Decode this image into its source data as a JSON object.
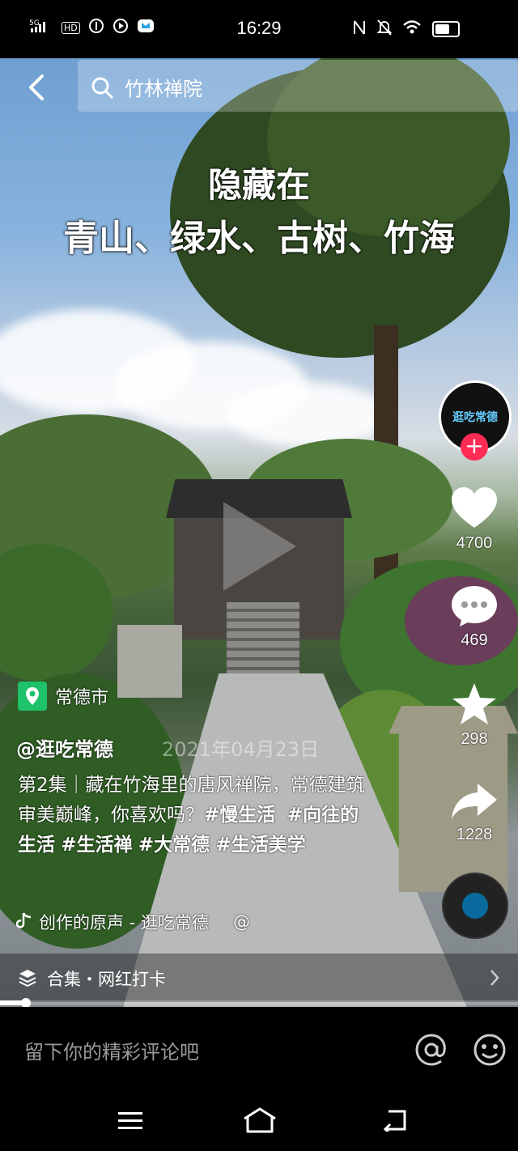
{
  "status_bar": {
    "network": "5G",
    "hd": "HD",
    "time": "16:29"
  },
  "search": {
    "query": "竹林禅院"
  },
  "overlay": {
    "line1": "隐藏在",
    "line2": "青山、绿水、古树、竹海"
  },
  "actions": {
    "avatar_text": "逛吃常德",
    "likes": "4700",
    "comments": "469",
    "favorites": "298",
    "shares": "1228"
  },
  "post": {
    "location": "常德市",
    "author": "@逛吃常德",
    "date": "2021年04月23日",
    "desc_prefix": "第2集｜藏在竹海里的唐风禅院，常德建筑审美巅峰，你喜欢吗？",
    "tags": [
      "#慢生活",
      "#向往的生活",
      "#生活禅",
      "#大常德",
      "#生活美学"
    ],
    "music": "创作的原声 - 逛吃常德",
    "music_at": "@",
    "collection": "合集・网红打卡",
    "progress": 0.05
  },
  "comment_bar": {
    "placeholder": "留下你的精彩评论吧"
  },
  "colors": {
    "accent_red": "#fe2c55",
    "location_green": "#1ec26a"
  }
}
